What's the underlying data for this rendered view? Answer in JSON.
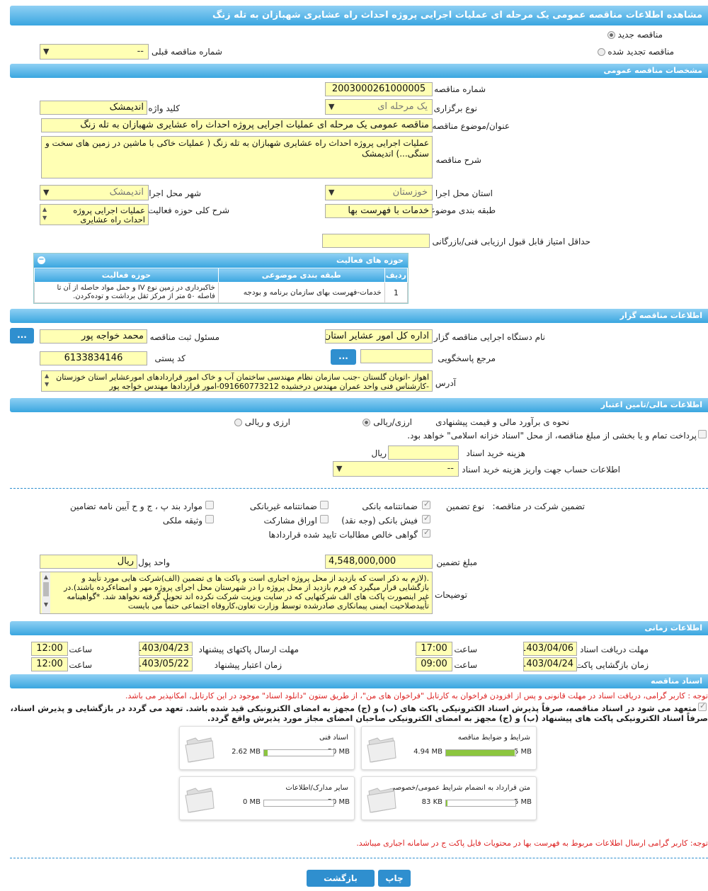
{
  "header": {
    "title": "مشاهده اطلاعات مناقصه عمومی یک مرحله ای عملیات اجرایی پروژه احداث راه عشایری شهبازان به تله زنگ"
  },
  "top": {
    "radio_new": "مناقصه جدید",
    "radio_renew": "مناقصه تجدید شده",
    "prev_label": "شماره مناقصه قبلی",
    "prev_value": "--"
  },
  "sections": {
    "general": "مشخصات مناقصه عمومی",
    "organizer": "اطلاعات مناقصه گزار",
    "finance": "اطلاعات مالی/تامین اعتبار",
    "timing": "اطلاعات زمانی",
    "docs": "اسناد مناقصه"
  },
  "general": {
    "number_label": "شماره مناقصه",
    "number": "2003000261000005",
    "type_label": "نوع برگزاری",
    "type": "یک مرحله ای",
    "keyword_label": "کلید واژه",
    "keyword": "اندیمشک",
    "subject_label": "عنوان/موضوع مناقصه",
    "subject": "مناقصه عمومی یک مرحله ای عملیات اجرایی  پروژه احداث راه عشایری شهبازان به تله زنگ",
    "desc_label": "شرح مناقصه",
    "desc": "عملیات اجرایی  پروژه احداث راه عشایری شهبازان به تله زنگ (   عملیات خاکی با ماشین در زمین های سخت و سنگی...) اندیمشک",
    "province_label": "استان محل اجرا",
    "province": "خوزستان",
    "city_label": "شهر محل اجرا",
    "city": "اندیمشک",
    "category_label": "طبقه بندی موضوعی",
    "category": "خدمات با فهرست بها",
    "scope_label": "شرح کلی حوزه فعالیت",
    "scope": "عملیات اجرایی  پروژه احداث راه عشایری",
    "min_score_label": "حداقل امتیاز قابل قبول ارزیابی فنی/بازرگانی",
    "min_score": ""
  },
  "activity_table": {
    "title": "حوزه های فعالیت",
    "headers": [
      "ردیف",
      "طبقه بندی موضوعی",
      "حوزه فعالیت"
    ],
    "rows": [
      [
        "1",
        "خدمات-فهرست بهای سازمان برنامه و بودجه",
        "خاکبرداری در زمین نوع IV و حمل مواد حاصله از آن تا فاصله ۵۰ متر از مرکز ثقل برداشت و توده‌کردن."
      ]
    ]
  },
  "organizer": {
    "org_label": "نام دستگاه اجرایی مناقصه گزار",
    "org": "اداره کل امور عشایر استان",
    "resp_label": "مسئول ثبت مناقصه",
    "resp": "محمد خواجه پور",
    "ref_label": "مرجع پاسخگویی",
    "ref": "",
    "postal_label": "کد پستی",
    "postal": "6133834146",
    "addr_label": "آدرس",
    "addr": "اهواز -اتوبان گلستان -جنب سازمان نظام مهندسی ساختمان آب و خاک امور قراردادهای امورعشایر استان خوزستان -کارشناس فنی واحد عمران مهندس درخشیده 09166077321‪2‬-امور قراردادها مهندس خواجه پور",
    "more_btn": "..."
  },
  "finance": {
    "estimate_label": "نحوه ی برآورد مالی و قیمت پیشنهادی",
    "opt_rial": "ارزی/ریالی",
    "opt_both": "ارزی و ریالی",
    "treasury": "پرداخت تمام و یا بخشی از مبلغ مناقصه، از محل \"اسناد خزانه اسلامی\" خواهد بود.",
    "fee_label": "هزینه خرید اسناد",
    "fee_unit": "ریال",
    "fee": "",
    "account_label": "اطلاعات حساب جهت واریز هزینه خرید اسناد",
    "account": "--"
  },
  "guarantee": {
    "label": "تضمین شرکت در مناقصه:",
    "type_label": "نوع تضمین",
    "items": [
      "ضمانتنامه بانکی",
      "ضمانتنامه غیربانکی",
      "موارد بند پ ، ج و ح آیین نامه تضامین",
      "فیش بانکی (وجه نقد)",
      "اوراق مشارکت",
      "وثیقه ملکی",
      "گواهی خالص مطالبات تایید شده قراردادها"
    ],
    "amount_label": "مبلغ تضمین",
    "amount": "4,548,000,000",
    "unit_label": "واحد پول",
    "unit": "ریال",
    "notes_label": "توضیحات",
    "notes": ".(لازم به ذکر است که بازدید از محل پروژه اجباری است و پاکت ها ی تضمین (الف)شرکت هایی مورد تأیید و بازگشایی قرار میگیرد که فرم بازدید از محل پروژه را در شهرستان محل اجرای پروژه مهر و امضاءکرده باشند).در غیر اینصورت پاکت های الف شرکتهایی که در سایت ویزیت شرکت نکرده اند تحویل گرفته نخواهد شد. *گواهینامه تأییدصلاحیت ایمنی پیمانکاری صادرشده توسط وزارت تعاون،کاروفاه اجتماعی حتماً می بایست"
  },
  "timing": {
    "receive_label": "مهلت دریافت اسناد",
    "receive_date": "1403/04/06",
    "receive_time": "17:00",
    "send_label": "مهلت ارسال پاکتهای پیشنهاد",
    "send_date": "1403/04/23",
    "send_time": "12:00",
    "open_label": "زمان بازگشایی پاکت ها",
    "open_date": "1403/04/24",
    "open_time": "09:00",
    "valid_label": "زمان اعتبار پیشنهاد",
    "valid_date": "1403/05/22",
    "valid_time": "12:00",
    "time_label": "ساعت"
  },
  "docs": {
    "note1": "توجه : کاربر گرامی، دریافت اسناد در مهلت قانونی و پس از افزودن فراخوان به کارتابل \"فراخوان های من\"، از طریق ستون \"دانلود اسناد\" موجود در این کارتابل، امکانپذیر می باشد.",
    "commit1": "متعهد می شود در اسناد مناقصه، صرفاً پذیرش اسناد الکترونیکی پاکت های (ب) و (ج) مجهز به امضای الکترونیکی قید شده باشد. تعهد می گردد در بازگشایی و پذیرش اسناد،",
    "commit2": "صرفاً اسناد الکترونیکی پاکت های پیشنهاد (ب) و (ج) مجهز به امضای الکترونیکی صاحبان امضای مجاز مورد پذیرش واقع گردد.",
    "cards": [
      {
        "title": "شرایط و ضوابط مناقصه",
        "cur": "4.94 MB",
        "max": "5 MB",
        "pct": 98.8
      },
      {
        "title": "اسناد فنی",
        "cur": "2.62 MB",
        "max": "50 MB",
        "pct": 5.2
      },
      {
        "title": "متن قرارداد به انضمام شرایط عمومی/خصوصی",
        "cur": "83 KB",
        "max": "5 MB",
        "pct": 1.6
      },
      {
        "title": "سایر مدارک/اطلاعات",
        "cur": "0 MB",
        "max": "50 MB",
        "pct": 0
      }
    ],
    "note2": "توجه: کاربر گرامی ارسال اطلاعات مربوط به فهرست بها در محتویات فایل پاکت ج در سامانه اجباری میباشد."
  },
  "buttons": {
    "print": "چاپ",
    "back": "بازگشت"
  },
  "colors": {
    "accent": "#3aa6e0",
    "field": "#ffffb4",
    "alert": "#dd2222",
    "progress": "#8cc63f"
  }
}
